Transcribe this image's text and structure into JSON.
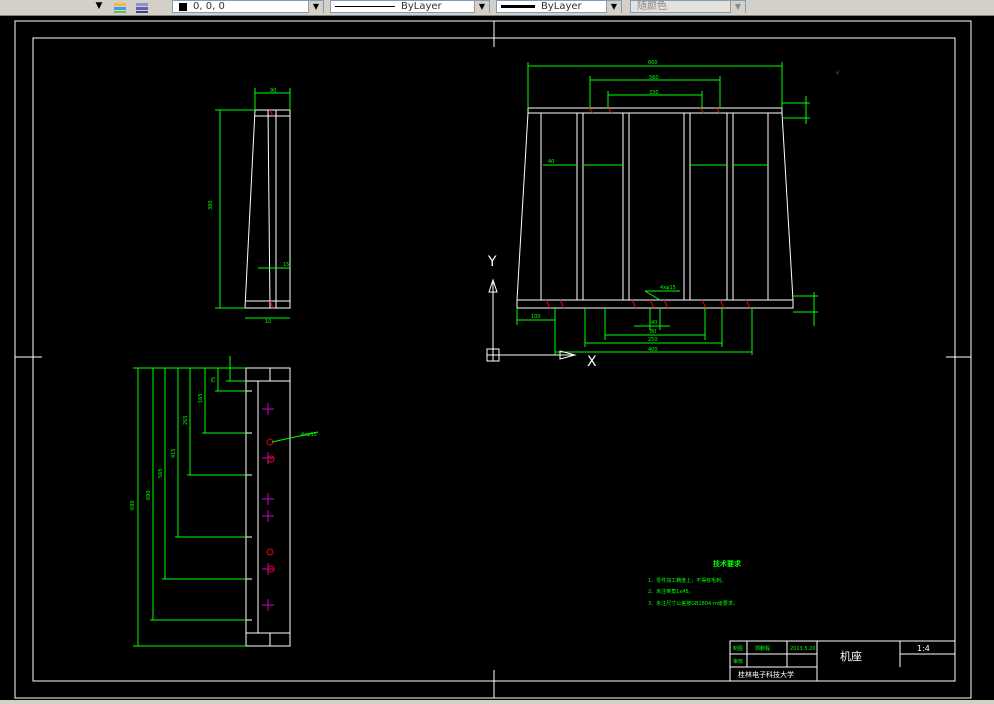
{
  "toolbar": {
    "color_value": "0, 0, 0",
    "linetype_value": "ByLayer",
    "lineweight_value": "ByLayer",
    "plotstyle_value": "随颜色"
  },
  "drawing": {
    "tech_title": "技术要求",
    "tech_notes": [
      "1、零件加工精度上，不得有毛刺。",
      "2、未注倒角1x45。",
      "3、未注尺寸公差按GB1804-m级要求。"
    ],
    "title_block": {
      "designer_label": "制图",
      "designer_name": "郭鹏程",
      "date": "2013.5.20",
      "checker_label": "审核",
      "part_name": "机座",
      "scale": "1:4",
      "school": "桂林电子科技大学"
    },
    "dims": {
      "side_top": "90",
      "side_height": "380",
      "side_small": "15",
      "side_bottom": "10",
      "front_top": "660",
      "front_mid": "560",
      "front_inner": "330",
      "front_slot": "40",
      "front_left": "100",
      "front_b1": "40",
      "front_b2": "80",
      "front_b3": "250",
      "front_b4": "400",
      "hole": "4xφ15",
      "plan_total": "690",
      "plan_a": "690",
      "plan_b": "565",
      "plan_c": "415",
      "plan_d": "265",
      "plan_e": "165",
      "plan_f": "75",
      "plan_hole": "4xφ15"
    },
    "axis_y": "Y",
    "axis_x": "X"
  }
}
